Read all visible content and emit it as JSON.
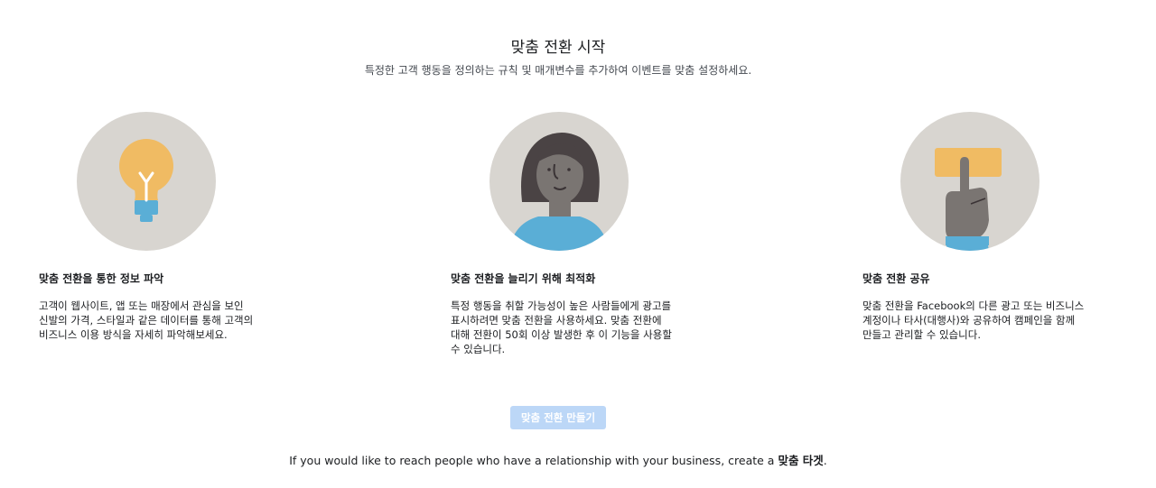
{
  "header": {
    "title": "맞춤 전환 시작",
    "subtitle": "특정한 고객 행동을 정의하는 규칙 및 매개변수를 추가하여 이벤트를 맞춤 설정하세요."
  },
  "features": [
    {
      "icon": "lightbulb-icon",
      "title": "맞춤 전환을 통한 정보 파악",
      "description": "고객이 웹사이트, 앱 또는 매장에서 관심을 보인 신발의 가격, 스타일과 같은 데이터를 통해 고객의 비즈니스 이용 방식을 자세히 파악해보세요."
    },
    {
      "icon": "person-icon",
      "title": "맞춤 전환을 늘리기 위해 최적화",
      "description": "특정 행동을 취할 가능성이 높은 사람들에게 광고를 표시하려면 맞춤 전환을 사용하세요. 맞춤 전환에 대해 전환이 50회 이상 발생한 후 이 기능을 사용할 수 있습니다."
    },
    {
      "icon": "hand-pointing-icon",
      "title": "맞춤 전환 공유",
      "description": "맞춤 전환을 Facebook의 다른 광고 또는 비즈니스 계정이나 타사(대행사)와 공유하여 캠페인을 함께 만들고 관리할 수 있습니다."
    }
  ],
  "cta": {
    "label": "맞춤 전환 만들기"
  },
  "footer": {
    "text": "If you would like to reach people who have a relationship with your business, create a",
    "link_label": "맞춤 타겟",
    "suffix": "."
  },
  "colors": {
    "circle_bg": "#d8d5d0",
    "bulb_yellow": "#f0bb63",
    "accent_blue": "#5aaed6",
    "skin": "#7a7572",
    "hair": "#4a4344",
    "button_disabled": "#bcd7f7"
  }
}
